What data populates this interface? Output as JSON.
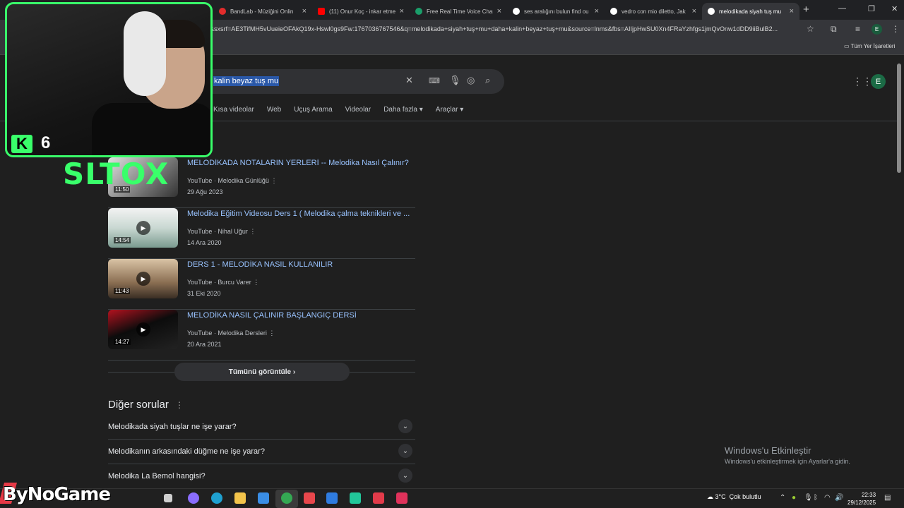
{
  "browser": {
    "tabs": [
      {
        "title": "BandLab - Müziğini Onlin",
        "color": "#e22c2c",
        "active": false
      },
      {
        "title": "(11) Onur Koç - inkar etme",
        "color": "#ff0000",
        "active": false
      },
      {
        "title": "Free Real Time Voice Chan",
        "color": "#1a9e6a",
        "active": false
      },
      {
        "title": "ses aralığını bulun find ou",
        "color": "#ffffff",
        "active": false
      },
      {
        "title": "vedro con mio diletto, Jak",
        "color": "#ffffff",
        "active": false
      },
      {
        "title": "melodikada siyah tuş mu",
        "color": "#ffffff",
        "active": true
      }
    ],
    "new_tab": "+",
    "url": "4&sxsrf=AE3TifMH5vUueieOFAkQ19x-Hswl0gs9Fw:1767036767546&q=melodikada+siyah+tuş+mu+daha+kalin+beyaz+tuş+mu&source=lnms&fbs=AIIjpHwSU0Xn4FRaYzhfgs1jmQvOnw1dDD9iiBulB2...",
    "profile_initial": "E",
    "bookmarks_all": "Tüm Yer İşaretleri"
  },
  "search": {
    "query": "kalin beyaz tuş mu",
    "avatar_initial": "E",
    "filters": [
      "Kısa videolar",
      "Web",
      "Uçuş Arama",
      "Videolar",
      "Daha fazla ▾",
      "Araçlar ▾"
    ]
  },
  "videos": [
    {
      "title": "MELODİKADA NOTALARIN YERLERİ -- Melodika Nasıl Çalınır?",
      "source": "YouTube · Melodika Günlüğü",
      "date": "29 Ağu 2023",
      "duration": "11:50",
      "thumb_color": "#c8c8c8"
    },
    {
      "title": "Melodika Eğitim Videosu Ders 1 ( Melodika çalma teknikleri ve ...",
      "source": "YouTube · Nihal Uğur",
      "date": "14 Ara 2020",
      "duration": "14:54",
      "thumb_color": "#dfe7e4"
    },
    {
      "title": "DERS 1 - MELODİKA NASIL KULLANILIR",
      "source": "YouTube · Burcu Varer",
      "date": "31 Eki 2020",
      "duration": "11:43",
      "thumb_color": "#b59a7a"
    },
    {
      "title": "MELODİKA NASIL ÇALINIR BAŞLANGIÇ DERSİ",
      "source": "YouTube · Melodika Dersleri",
      "date": "20 Ara 2021",
      "duration": "14:27",
      "thumb_color": "#1a1a1a"
    }
  ],
  "see_all": "Tümünü görüntüle ›",
  "people_also_ask": {
    "title": "Diğer sorular",
    "questions": [
      "Melodikada siyah tuşlar ne işe yarar?",
      "Melodikanın arkasındaki düğme ne işe yarar?",
      "Melodika La Bemol hangisi?"
    ]
  },
  "windows_activation": {
    "title": "Windows'u Etkinleştir",
    "subtitle": "Windows'u etkinleştirmek için Ayarlar'a gidin."
  },
  "overlay": {
    "k_badge": "K",
    "k_number": "6",
    "streamer": "SLTOX",
    "watermark": "ByNoGame"
  },
  "taskbar": {
    "weather_temp": "3°C",
    "weather_desc": "Çok bulutlu",
    "time": "22:33",
    "date": "29/12/2025",
    "apps": [
      {
        "name": "task-view",
        "color": "#d0d0d0"
      },
      {
        "name": "copilot",
        "color": "#8b6dff"
      },
      {
        "name": "edge",
        "color": "#1fa1d1"
      },
      {
        "name": "file-explorer",
        "color": "#f3c44b"
      },
      {
        "name": "store",
        "color": "#3a8ee6"
      },
      {
        "name": "chrome",
        "color": "#34a853"
      },
      {
        "name": "office",
        "color": "#e8474c"
      },
      {
        "name": "mail",
        "color": "#2f7ce0"
      },
      {
        "name": "app-green",
        "color": "#22c79a"
      },
      {
        "name": "app-red",
        "color": "#e23b4a"
      },
      {
        "name": "app-pink",
        "color": "#e0325b"
      }
    ]
  },
  "colors": {
    "accent_green": "#39ff6a",
    "link_blue": "#99c3ff",
    "background": "#1f1f1f"
  }
}
